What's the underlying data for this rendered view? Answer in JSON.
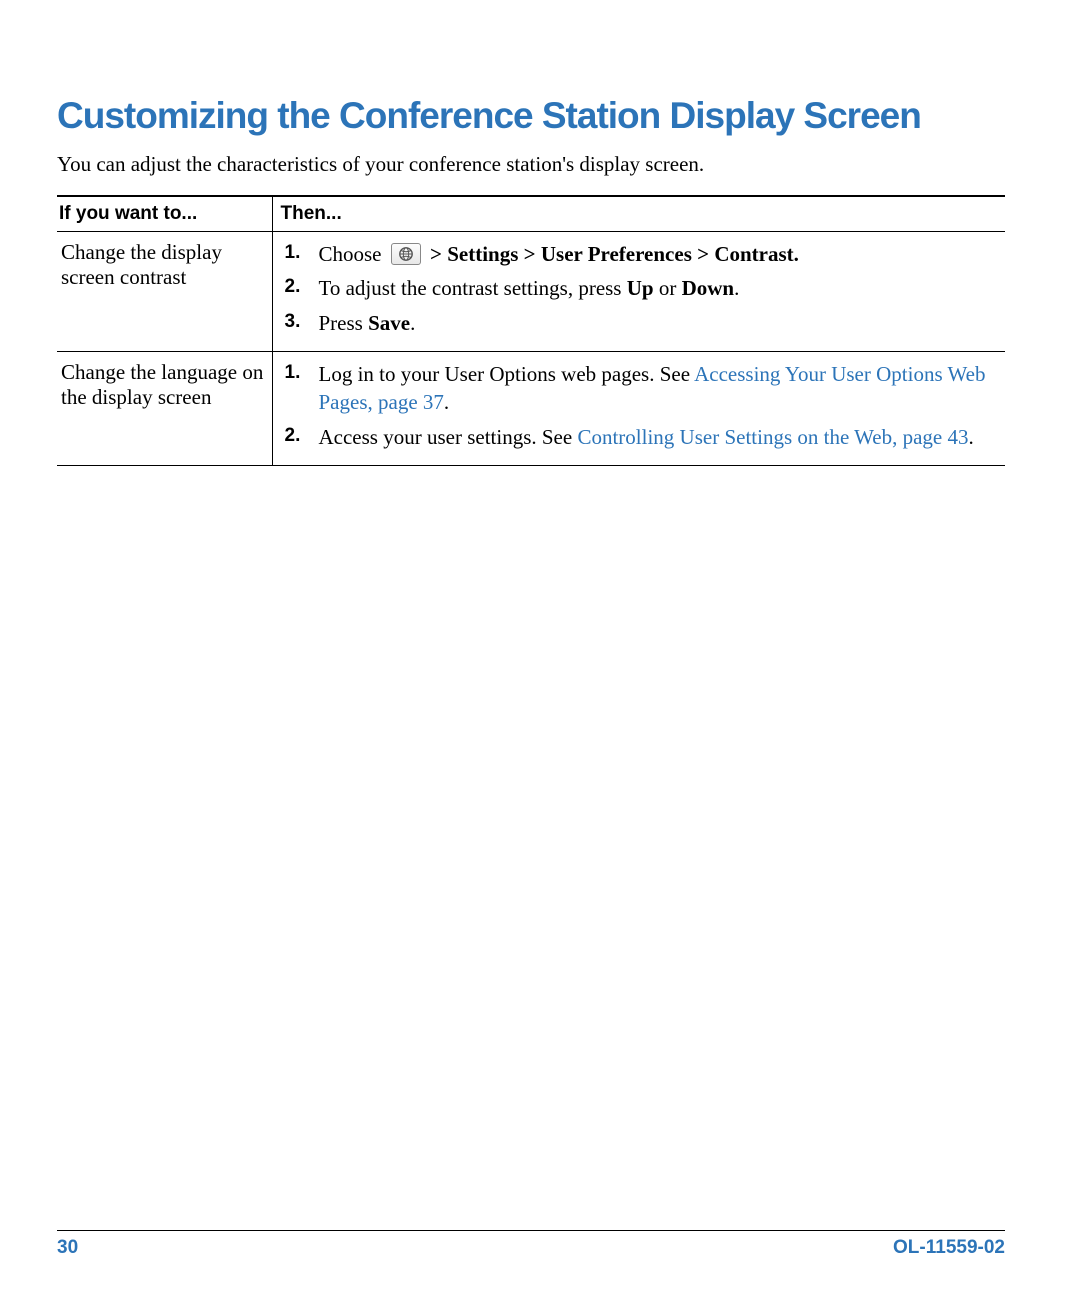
{
  "heading": "Customizing the Conference Station Display Screen",
  "intro": "You can adjust the characteristics of your conference station's display screen.",
  "table": {
    "headers": {
      "col1": "If you want to...",
      "col2": "Then..."
    },
    "rows": [
      {
        "want": "Change the display screen contrast",
        "steps": {
          "s1_pre": "Choose ",
          "s1_post": " > Settings > User Preferences > Contrast.",
          "s2_a": "To adjust the contrast settings, press ",
          "s2_b": "Up",
          "s2_c": " or ",
          "s2_d": "Down",
          "s2_e": ".",
          "s3_a": "Press ",
          "s3_b": "Save",
          "s3_c": "."
        }
      },
      {
        "want": "Change the language on the display screen",
        "steps": {
          "s1_a": "Log in to your User Options web pages. See ",
          "s1_link": "Accessing Your User Options Web Pages, page 37",
          "s1_c": ".",
          "s2_a": "Access your user settings. See ",
          "s2_link": "Controlling User Settings on the Web, page 43",
          "s2_c": "."
        }
      }
    ]
  },
  "footer": {
    "page": "30",
    "docid": "OL-11559-02"
  }
}
